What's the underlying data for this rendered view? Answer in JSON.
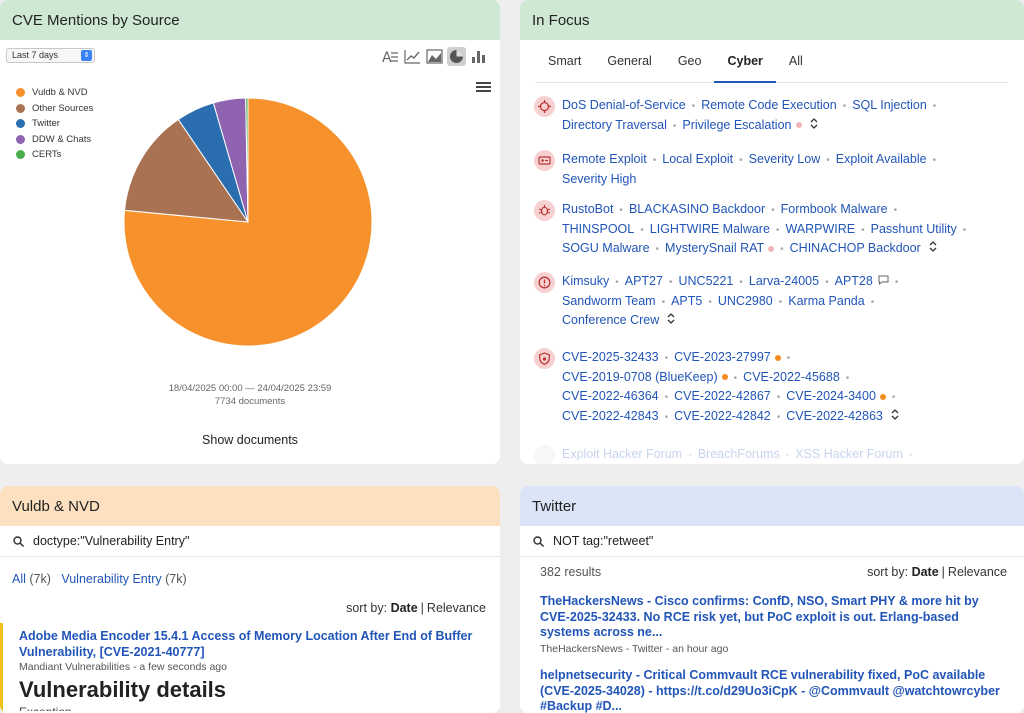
{
  "cve_panel": {
    "title": "CVE Mentions by Source",
    "range_select": "Last 7 days",
    "legend": [
      {
        "label": "Vuldb & NVD",
        "color": "#f7912b"
      },
      {
        "label": "Other Sources",
        "color": "#a97252"
      },
      {
        "label": "Twitter",
        "color": "#2a6eb0"
      },
      {
        "label": "DDW & Chats",
        "color": "#8f63b0"
      },
      {
        "label": "CERTs",
        "color": "#4cad4c"
      }
    ],
    "date_range": "18/04/2025 00:00 — 24/04/2025 23:59",
    "doc_count": "7734 documents",
    "show_documents": "Show documents",
    "toolbar_icons": [
      "text-direction-icon",
      "line-chart-icon",
      "area-chart-icon",
      "pie-chart-icon",
      "bar-chart-icon"
    ],
    "chart_data": {
      "type": "pie",
      "categories": [
        "Vuldb & NVD",
        "Other Sources",
        "Twitter",
        "DDW & Chats",
        "CERTs"
      ],
      "values": [
        76.5,
        14.0,
        5.0,
        4.2,
        0.3
      ],
      "colors": [
        "#f7912b",
        "#a97252",
        "#2a6eb0",
        "#8f63b0",
        "#4cad4c"
      ]
    }
  },
  "focus_panel": {
    "title": "In Focus",
    "tabs": [
      "Smart",
      "General",
      "Geo",
      "Cyber",
      "All"
    ],
    "active_tab": "Cyber",
    "groups": [
      {
        "icon": "crosshair-icon",
        "lines": [
          [
            {
              "t": "DoS Denial-of-Service"
            },
            {
              "t": "Remote Code Execution"
            },
            {
              "t": "SQL Injection",
              "trail": "sep"
            }
          ],
          [
            {
              "t": "Directory Traversal"
            },
            {
              "t": "Privilege Escalation",
              "dot": "pink",
              "chev": true
            }
          ]
        ]
      },
      {
        "icon": "exploit-icon",
        "lines": [
          [
            {
              "t": "Remote Exploit"
            },
            {
              "t": "Local Exploit"
            },
            {
              "t": "Severity Low"
            },
            {
              "t": "Exploit Available",
              "trail": "sep"
            }
          ],
          [
            {
              "t": "Severity High"
            }
          ]
        ]
      },
      {
        "icon": "malware-bug-icon",
        "lines": [
          [
            {
              "t": "RustoBot"
            },
            {
              "t": "BLACKASINO Backdoor"
            },
            {
              "t": "Formbook Malware",
              "trail": "sep"
            }
          ],
          [
            {
              "t": "THINSPOOL"
            },
            {
              "t": "LIGHTWIRE Malware"
            },
            {
              "t": "WARPWIRE"
            },
            {
              "t": "Passhunt Utility",
              "trail": "sep"
            }
          ],
          [
            {
              "t": "SOGU Malware"
            },
            {
              "t": "MysterySnail RAT",
              "dot": "pink"
            },
            {
              "t": "CHINACHOP Backdoor",
              "chev": true
            }
          ]
        ]
      },
      {
        "icon": "threat-actor-icon",
        "lines": [
          [
            {
              "t": "Kimsuky"
            },
            {
              "t": "APT27"
            },
            {
              "t": "UNC5221"
            },
            {
              "t": "Larva-24005"
            },
            {
              "t": "APT28",
              "comment": true,
              "trail": "sep"
            }
          ],
          [
            {
              "t": "Sandworm Team"
            },
            {
              "t": "APT5"
            },
            {
              "t": "UNC2980"
            },
            {
              "t": "Karma Panda",
              "trail": "sep"
            }
          ],
          [
            {
              "t": "Conference Crew",
              "chev": true
            }
          ]
        ]
      },
      {
        "icon": "shield-bug-icon",
        "lines": [
          [
            {
              "t": "CVE-2025-32433"
            },
            {
              "t": "CVE-2023-27997",
              "dot": "orange",
              "trail": "sep"
            }
          ],
          [
            {
              "t": "CVE-2019-0708 (BlueKeep)",
              "dot": "orange"
            },
            {
              "t": "CVE-2022-45688",
              "trail": "sep"
            }
          ],
          [
            {
              "t": "CVE-2022-46364"
            },
            {
              "t": "CVE-2022-42867"
            },
            {
              "t": "CVE-2024-3400",
              "dot": "orange",
              "trail": "sep"
            }
          ],
          [
            {
              "t": "CVE-2022-42843"
            },
            {
              "t": "CVE-2022-42842"
            },
            {
              "t": "CVE-2022-42863",
              "chev": true
            }
          ]
        ]
      }
    ],
    "faded_line": [
      {
        "t": "Exploit Hacker Forum"
      },
      {
        "t": "BreachForums"
      },
      {
        "t": "XSS Hacker Forum",
        "trail": "sep"
      }
    ]
  },
  "vuldb_panel": {
    "title": "Vuldb & NVD",
    "query": "doctype:\"Vulnerability Entry\"",
    "facet_all": "All",
    "facet_all_count": "(7k)",
    "facet_vuln": "Vulnerability Entry",
    "facet_vuln_count": "(7k)",
    "sort_label": "sort by:",
    "sort_date": "Date",
    "sort_relevance": "Relevance",
    "result_title": "Adobe Media Encoder 15.4.1 Access of Memory Location After End of Buffer Vulnerability, [CVE-2021-40777]",
    "result_meta": "Mandiant Vulnerabilities - a few seconds ago",
    "result_heading": "Vulnerability details",
    "result_sub": "Exception"
  },
  "twitter_panel": {
    "title": "Twitter",
    "query": "NOT tag:\"retweet\"",
    "results_count": "382 results",
    "sort_label": "sort by:",
    "sort_date": "Date",
    "sort_relevance": "Relevance",
    "tweets": [
      {
        "title": "TheHackersNews - Cisco confirms: ConfD, NSO, Smart PHY & more hit by CVE-2025-32433. No RCE risk yet, but PoC exploit is out. Erlang-based systems across ne...",
        "meta": "TheHackersNews - Twitter - an hour ago"
      },
      {
        "title": "helpnetsecurity - Critical Commvault RCE vulnerability fixed, PoC available (CVE-2025-34028) - https://t.co/d29Uo3iCpK - @Commvault @watchtowrcyber #Backup #D...",
        "meta": ""
      }
    ]
  }
}
